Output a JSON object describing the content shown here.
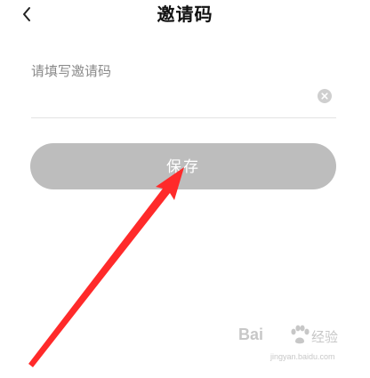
{
  "header": {
    "title": "邀请码",
    "back_icon": "chevron-left-icon"
  },
  "form": {
    "label": "请填写邀请码",
    "input_value": "",
    "clear_icon": "clear-circle-icon"
  },
  "actions": {
    "save_label": "保存",
    "save_color": "#bdbdbd"
  },
  "annotation": {
    "arrow_color": "#ff2a2a"
  },
  "watermark": {
    "brand": "Bai",
    "name": "经验",
    "url": "jingyan.baidu.com"
  }
}
